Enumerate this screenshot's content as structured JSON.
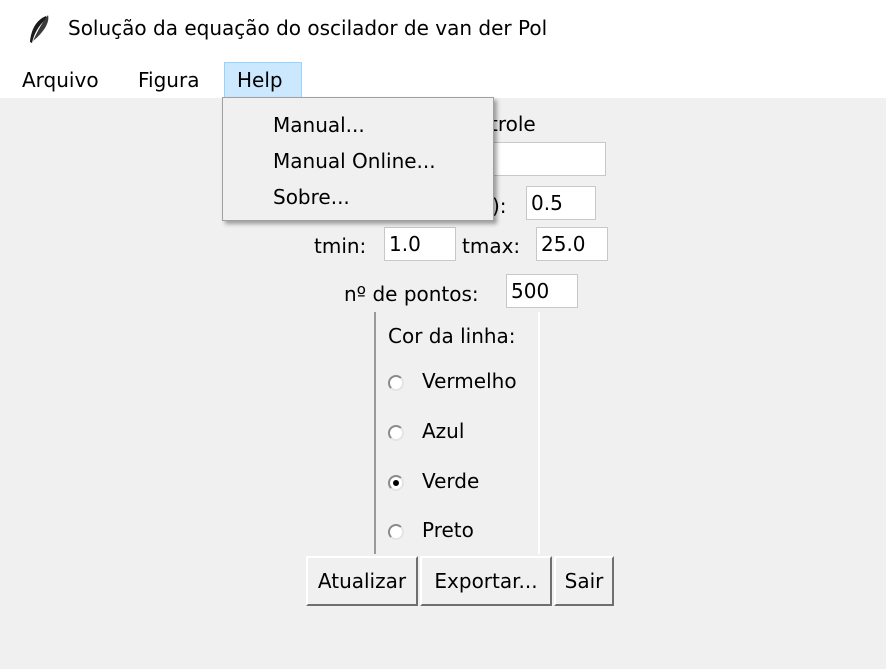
{
  "window": {
    "title": "Solução da equação do oscilador de van der Pol",
    "icon": "feather-icon"
  },
  "menubar": {
    "items": [
      {
        "label": "Arquivo"
      },
      {
        "label": "Figura"
      },
      {
        "label": "Help"
      }
    ],
    "active": "Help"
  },
  "help_menu": {
    "items": [
      {
        "label": "Manual..."
      },
      {
        "label": "Manual Online..."
      },
      {
        "label": "Sobre..."
      }
    ]
  },
  "controls": {
    "heading_partial": "trole",
    "param_label_partial": "):",
    "param_value": "0.5",
    "tmin_label": "tmin:",
    "tmin_value": "1.0",
    "tmax_label": "tmax:",
    "tmax_value": "25.0",
    "npoints_label": "nº de pontos:",
    "npoints_value": "500"
  },
  "line_color": {
    "title": "Cor da linha:",
    "options": [
      {
        "label": "Vermelho",
        "selected": false
      },
      {
        "label": "Azul",
        "selected": false
      },
      {
        "label": "Verde",
        "selected": true
      },
      {
        "label": "Preto",
        "selected": false
      }
    ]
  },
  "buttons": {
    "update": "Atualizar",
    "export": "Exportar...",
    "exit": "Sair"
  }
}
